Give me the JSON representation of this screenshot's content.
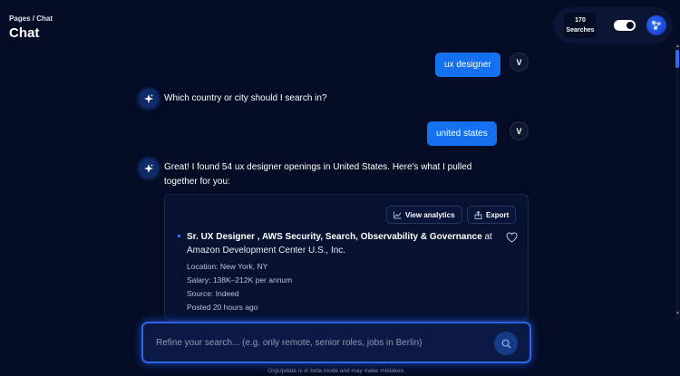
{
  "header": {
    "breadcrumb": "Pages / Chat",
    "title": "Chat"
  },
  "top_controls": {
    "search_count": "170",
    "search_label": "Searches",
    "dark_mode": true
  },
  "messages": {
    "user_1": "ux designer",
    "user_2": "united states",
    "user_avatar_letter": "V",
    "bot_1": "Which country or city should I search in?",
    "bot_2_line1": "Great! I found 54 ux designer openings in United States. Here's what I pulled",
    "bot_2_line2": "together for you:"
  },
  "results_card": {
    "view_analytics_label": "View analytics",
    "export_label": "Export",
    "job": {
      "title": "Sr. UX Designer , AWS Security, Search, Observability & Governance",
      "at": "at",
      "company": "Amazon Development Center U.S., Inc.",
      "location": "Location: New York, NY",
      "salary": "Salary: 138K–212K per annum",
      "source": "Source: Indeed",
      "posted": "Posted 20 hours ago"
    }
  },
  "input": {
    "placeholder": "Refine your search... (e.g. only remote, senior roles, jobs in Berlin)",
    "value": ""
  },
  "footer": {
    "disclaimer": "OrgUpdate is in beta mode and may make mistakes."
  },
  "colors": {
    "background": "#030c24",
    "accent": "#1570ef",
    "card": "#061230"
  },
  "icons": {
    "bot": "sparkle-icon",
    "analytics": "trend-chart-icon",
    "export": "export-icon",
    "favorite": "heart-icon",
    "send": "search-icon",
    "account": "network-icon"
  }
}
